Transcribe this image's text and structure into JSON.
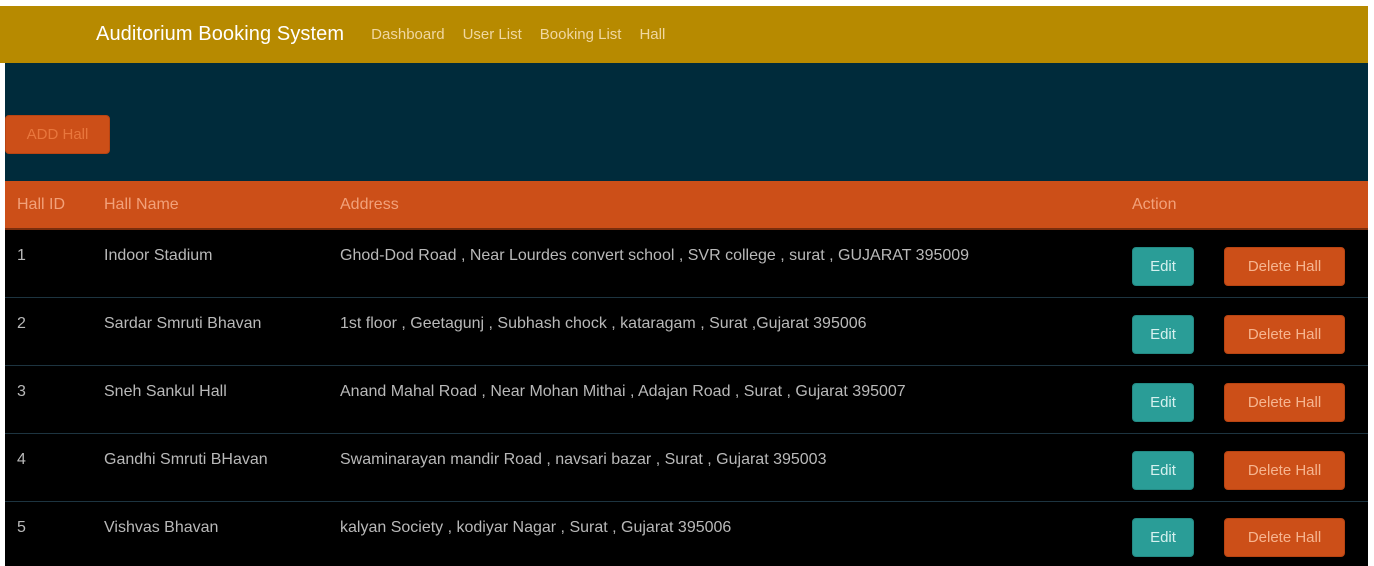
{
  "nav": {
    "brand": "Auditorium Booking System",
    "links": [
      "Dashboard",
      "User List",
      "Booking List",
      "Hall"
    ]
  },
  "actions": {
    "add_hall": "ADD Hall"
  },
  "table": {
    "headers": [
      "Hall ID",
      "Hall Name",
      "Address",
      "Action"
    ],
    "edit_label": "Edit",
    "delete_label": "Delete Hall",
    "rows": [
      {
        "id": "1",
        "name": "Indoor Stadium",
        "address": "Ghod-Dod Road , Near Lourdes convert school , SVR college , surat , GUJARAT 395009"
      },
      {
        "id": "2",
        "name": "Sardar Smruti Bhavan",
        "address": "1st floor , Geetagunj , Subhash chock , kataragam , Surat ,Gujarat 395006"
      },
      {
        "id": "3",
        "name": "Sneh Sankul Hall",
        "address": "Anand Mahal Road , Near Mohan Mithai , Adajan Road , Surat , Gujarat 395007"
      },
      {
        "id": "4",
        "name": "Gandhi Smruti BHavan",
        "address": "Swaminarayan mandir Road , navsari bazar , Surat , Gujarat 395003"
      },
      {
        "id": "5",
        "name": "Vishvas Bhavan",
        "address": "kalyan Society , kodiyar Nagar , Surat , Gujarat 395006"
      }
    ]
  },
  "colors": {
    "navbar": "#b78a00",
    "hero": "#002b3b",
    "accent_orange": "#cc4f18",
    "edit_teal": "#2a9d97",
    "row_bg": "#000000"
  }
}
